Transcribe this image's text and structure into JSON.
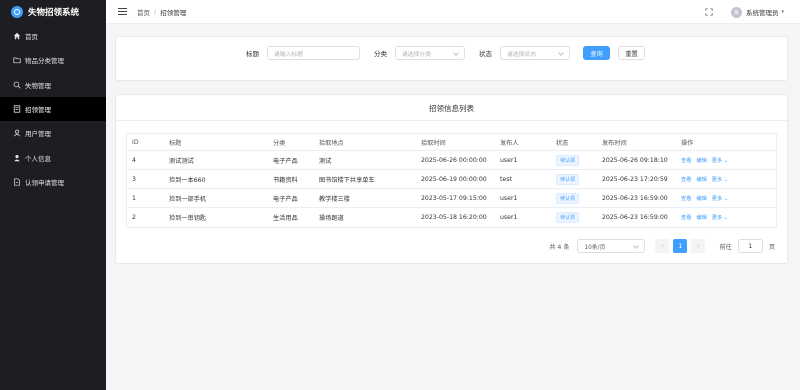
{
  "app": {
    "title": "失物招领系统"
  },
  "sidebar": {
    "items": [
      {
        "label": "首页",
        "icon": "home-icon"
      },
      {
        "label": "物品分类管理",
        "icon": "folder-icon"
      },
      {
        "label": "失物管理",
        "icon": "search-icon"
      },
      {
        "label": "招领管理",
        "icon": "document-icon",
        "active": true
      },
      {
        "label": "用户管理",
        "icon": "users-icon"
      },
      {
        "label": "个人信息",
        "icon": "user-icon"
      },
      {
        "label": "认领申请管理",
        "icon": "file-icon"
      }
    ]
  },
  "header": {
    "breadcrumb": [
      "首页",
      "招领管理"
    ],
    "username": "系统管理员"
  },
  "search": {
    "title_label": "标题",
    "title_placeholder": "请输入标题",
    "category_label": "分类",
    "category_placeholder": "请选择分类",
    "status_label": "状态",
    "status_placeholder": "请选择状态",
    "search_button": "查询",
    "reset_button": "重置"
  },
  "table": {
    "title": "招领信息列表",
    "columns": [
      "ID",
      "标题",
      "分类",
      "拾取地点",
      "拾取时间",
      "发布人",
      "状态",
      "发布时间",
      "操作"
    ],
    "rows": [
      {
        "id": "4",
        "title": "测试测试",
        "category": "电子产品",
        "location": "测试",
        "time": "2025-06-26 00:00:00",
        "publisher": "user1",
        "status": "待认领",
        "ptime": "2025-06-26 09:18:10"
      },
      {
        "id": "3",
        "title": "捡到一本660",
        "category": "书籍资料",
        "location": "图书馆楼下共享单车",
        "time": "2025-06-19 00:00:00",
        "publisher": "test",
        "status": "待认领",
        "ptime": "2025-06-23 17:20:59"
      },
      {
        "id": "1",
        "title": "捡到一部手机",
        "category": "电子产品",
        "location": "教学楼三楼",
        "time": "2023-05-17 09:15:00",
        "publisher": "user1",
        "status": "待认领",
        "ptime": "2025-06-23 16:59:00"
      },
      {
        "id": "2",
        "title": "捡到一串钥匙",
        "category": "生活用品",
        "location": "操场跑道",
        "time": "2023-05-18 16:20:00",
        "publisher": "user1",
        "status": "待认领",
        "ptime": "2025-06-23 16:59:00"
      }
    ],
    "ops": {
      "view": "查看",
      "edit": "编辑",
      "more": "更多"
    }
  },
  "pagination": {
    "total": "共 4 条",
    "page_size": "10条/页",
    "current_page": "1",
    "goto_label": "前往",
    "goto_value": "1",
    "page_suffix": "页"
  },
  "colors": {
    "accent": "#409eff",
    "sidebar_bg": "#1d1e22"
  }
}
